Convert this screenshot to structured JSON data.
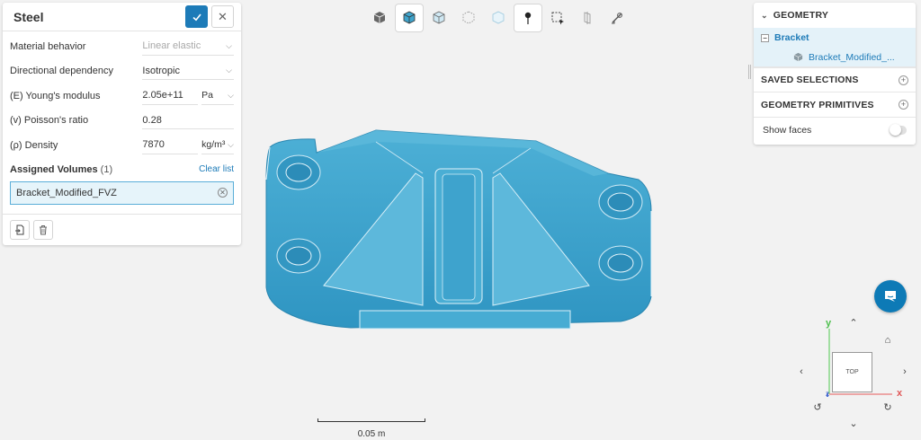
{
  "material_panel": {
    "title": "Steel",
    "properties": [
      {
        "label": "Material behavior",
        "value": "Linear elastic",
        "disabled": true
      },
      {
        "label": "Directional dependency",
        "value": "Isotropic"
      },
      {
        "label": "(E) Young's modulus",
        "value": "2.05e+11",
        "unit": "Pa"
      },
      {
        "label": "(v) Poisson's ratio",
        "value": "0.28"
      },
      {
        "label": "(ρ) Density",
        "value": "7870",
        "unit": "kg/m³"
      }
    ],
    "assigned_label": "Assigned Volumes",
    "assigned_count": "(1)",
    "clear_label": "Clear list",
    "assigned_items": [
      "Bracket_Modified_FVZ"
    ]
  },
  "tree_panel": {
    "geometry_label": "GEOMETRY",
    "root_node": "Bracket",
    "child_node": "Bracket_Modified_...",
    "saved_selections_label": "SAVED SELECTIONS",
    "primitives_label": "GEOMETRY PRIMITIVES",
    "show_faces_label": "Show faces"
  },
  "navcube": {
    "face_label": "TOP",
    "axis_y": "y",
    "axis_x": "x",
    "axis_z": "z"
  },
  "scale_bar": {
    "label": "0.05 m"
  },
  "colors": {
    "accent": "#1d7bb8",
    "model_fill": "#3fa4cc",
    "chat": "#0d7ab6"
  },
  "toolbar": {
    "icons": [
      "solid-cube-icon",
      "shaded-cube-icon",
      "wire-cube-icon",
      "points-cube-icon",
      "ghost-cube-icon",
      "pin-icon",
      "box-select-icon",
      "section-icon",
      "measure-icon"
    ],
    "active_index": [
      1,
      5
    ]
  }
}
